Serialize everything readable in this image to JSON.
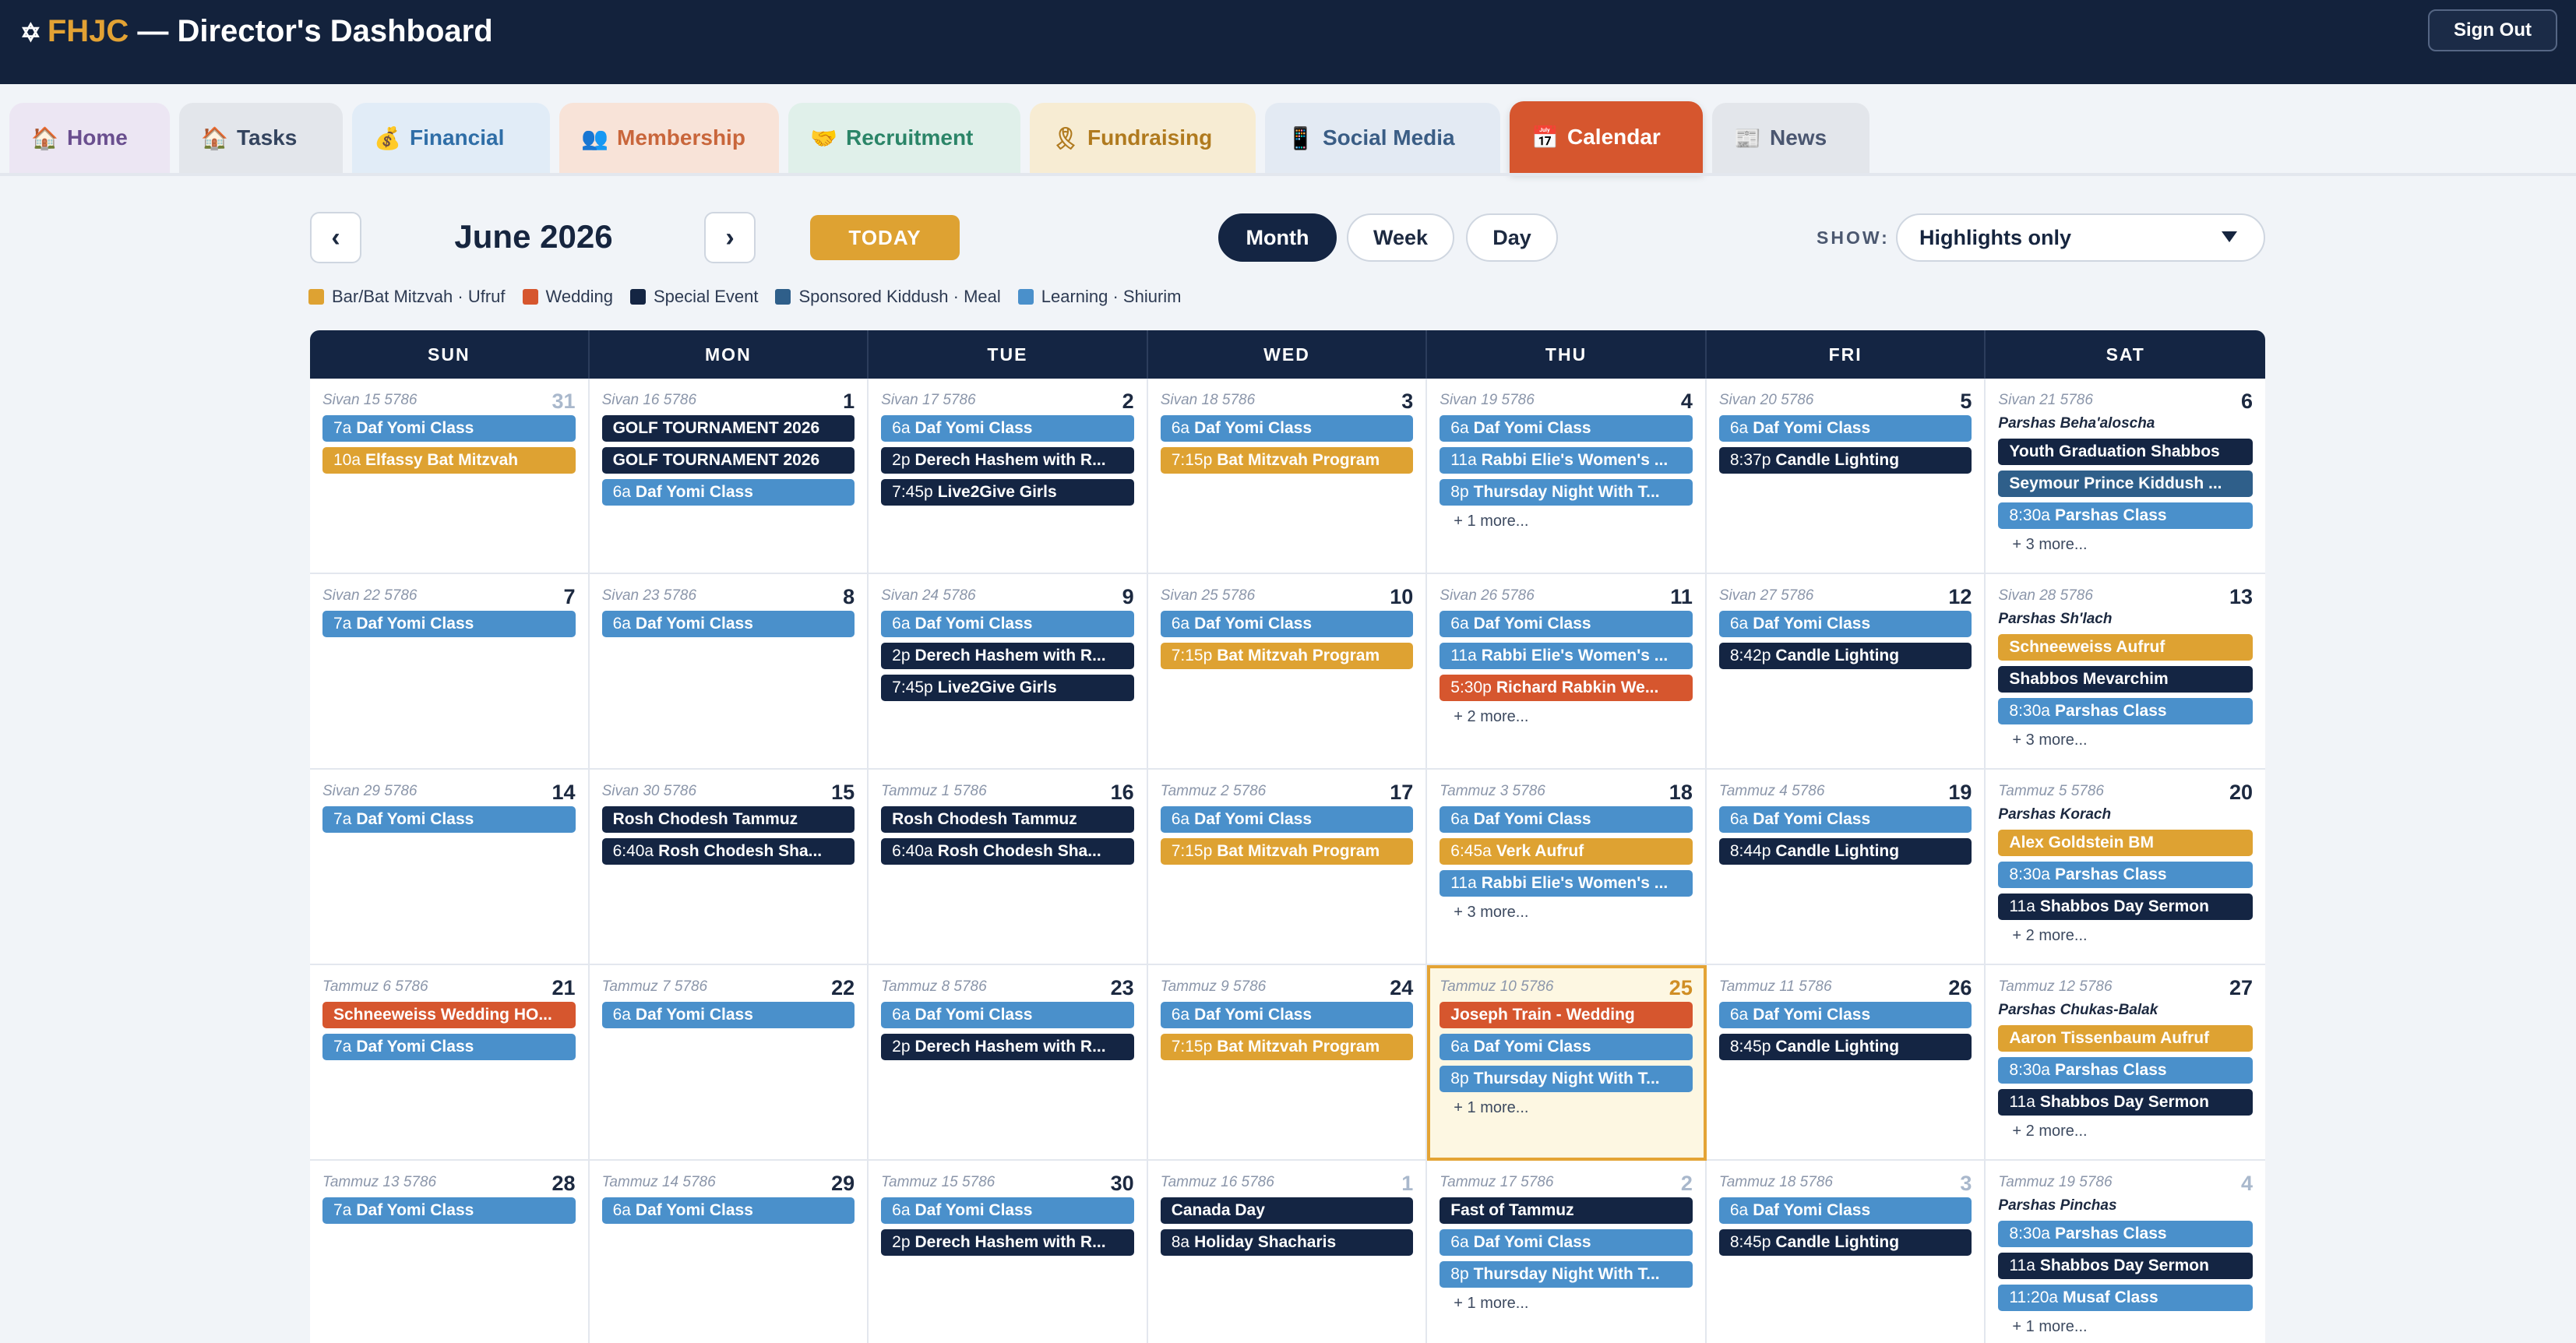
{
  "header": {
    "star": "✡",
    "org": "FHJC",
    "title": " — Director's Dashboard",
    "signout": "Sign Out"
  },
  "tabs": [
    {
      "id": "home",
      "icon": "🏠",
      "label": "Home",
      "bg": "#ece6f3",
      "color": "#6a4f8f"
    },
    {
      "id": "tasks",
      "icon": "🏠",
      "label": "Tasks",
      "bg": "#e3e6eb",
      "color": "#34445e"
    },
    {
      "id": "financial",
      "icon": "💰",
      "label": "Financial",
      "bg": "#e1ecf7",
      "color": "#2f6ea7"
    },
    {
      "id": "membership",
      "icon": "👥",
      "label": "Membership",
      "bg": "#f8e3d8",
      "color": "#c9663b"
    },
    {
      "id": "recruitment",
      "icon": "🤝",
      "label": "Recruitment",
      "bg": "#e0f0ea",
      "color": "#2b8568"
    },
    {
      "id": "fundraising",
      "icon": "🎗",
      "label": "Fundraising",
      "bg": "#f7ecd3",
      "color": "#b07a1e"
    },
    {
      "id": "social_media",
      "icon": "📱",
      "label": "Social Media",
      "bg": "#e3eaf3",
      "color": "#3a5d85"
    },
    {
      "id": "calendar",
      "icon": "📅",
      "label": "Calendar",
      "bg": "#d6562e",
      "color": "#ffffff"
    },
    {
      "id": "news",
      "icon": "📰",
      "label": "News",
      "bg": "#e3e6eb",
      "color": "#4a5670"
    }
  ],
  "active_tab": "calendar",
  "controls": {
    "prev": "‹",
    "next": "›",
    "month_title": "June 2026",
    "today": "TODAY",
    "views": [
      "Month",
      "Week",
      "Day"
    ],
    "active_view": "Month",
    "show_label": "SHOW:",
    "show_value": "Highlights only"
  },
  "legend": [
    {
      "label": "Bar/Bat Mitzvah · Ufruf",
      "color": "#dea232"
    },
    {
      "label": "Wedding",
      "color": "#d6562e"
    },
    {
      "label": "Special Event",
      "color": "#142543"
    },
    {
      "label": "Sponsored Kiddush · Meal",
      "color": "#2f5f8a"
    },
    {
      "label": "Learning · Shiurim",
      "color": "#4a90cb"
    }
  ],
  "colors": {
    "bar": "#dea232",
    "wed": "#d6562e",
    "spec": "#142543",
    "kid": "#2f5f8a",
    "learn": "#4a90cb"
  },
  "weekdays": [
    "SUN",
    "MON",
    "TUE",
    "WED",
    "THU",
    "FRI",
    "SAT"
  ],
  "weeks": [
    [
      {
        "hebrew": "Sivan 15 5786",
        "day": "31",
        "other": true,
        "events": [
          {
            "time": "7a",
            "title": "Daf Yomi Class",
            "type": "learn"
          },
          {
            "time": "10a",
            "title": "Elfassy Bat Mitzvah",
            "type": "bar"
          }
        ]
      },
      {
        "hebrew": "Sivan 16 5786",
        "day": "1",
        "events": [
          {
            "title": "GOLF TOURNAMENT 2026",
            "type": "spec"
          },
          {
            "title": "GOLF TOURNAMENT 2026",
            "type": "spec"
          },
          {
            "time": "6a",
            "title": "Daf Yomi Class",
            "type": "learn"
          }
        ]
      },
      {
        "hebrew": "Sivan 17 5786",
        "day": "2",
        "events": [
          {
            "time": "6a",
            "title": "Daf Yomi Class",
            "type": "learn"
          },
          {
            "time": "2p",
            "title": "Derech Hashem with R...",
            "type": "spec"
          },
          {
            "time": "7:45p",
            "title": "Live2Give Girls",
            "type": "spec"
          }
        ]
      },
      {
        "hebrew": "Sivan 18 5786",
        "day": "3",
        "events": [
          {
            "time": "6a",
            "title": "Daf Yomi Class",
            "type": "learn"
          },
          {
            "time": "7:15p",
            "title": "Bat Mitzvah Program",
            "type": "bar"
          }
        ]
      },
      {
        "hebrew": "Sivan 19 5786",
        "day": "4",
        "events": [
          {
            "time": "6a",
            "title": "Daf Yomi Class",
            "type": "learn"
          },
          {
            "time": "11a",
            "title": "Rabbi Elie's Women's ...",
            "type": "learn"
          },
          {
            "time": "8p",
            "title": "Thursday Night With T...",
            "type": "learn"
          }
        ],
        "more": "+ 1 more..."
      },
      {
        "hebrew": "Sivan 20 5786",
        "day": "5",
        "events": [
          {
            "time": "6a",
            "title": "Daf Yomi Class",
            "type": "learn"
          },
          {
            "time": "8:37p",
            "title": "Candle Lighting",
            "type": "spec"
          }
        ]
      },
      {
        "hebrew": "Sivan 21 5786",
        "day": "6",
        "parsha": "Parshas Beha'aloscha",
        "events": [
          {
            "title": "Youth Graduation Shabbos",
            "type": "spec"
          },
          {
            "title": "Seymour Prince Kiddush ...",
            "type": "kid"
          },
          {
            "time": "8:30a",
            "title": "Parshas Class",
            "type": "learn"
          }
        ],
        "more": "+ 3 more..."
      }
    ],
    [
      {
        "hebrew": "Sivan 22 5786",
        "day": "7",
        "events": [
          {
            "time": "7a",
            "title": "Daf Yomi Class",
            "type": "learn"
          }
        ]
      },
      {
        "hebrew": "Sivan 23 5786",
        "day": "8",
        "events": [
          {
            "time": "6a",
            "title": "Daf Yomi Class",
            "type": "learn"
          }
        ]
      },
      {
        "hebrew": "Sivan 24 5786",
        "day": "9",
        "events": [
          {
            "time": "6a",
            "title": "Daf Yomi Class",
            "type": "learn"
          },
          {
            "time": "2p",
            "title": "Derech Hashem with R...",
            "type": "spec"
          },
          {
            "time": "7:45p",
            "title": "Live2Give Girls",
            "type": "spec"
          }
        ]
      },
      {
        "hebrew": "Sivan 25 5786",
        "day": "10",
        "events": [
          {
            "time": "6a",
            "title": "Daf Yomi Class",
            "type": "learn"
          },
          {
            "time": "7:15p",
            "title": "Bat Mitzvah Program",
            "type": "bar"
          }
        ]
      },
      {
        "hebrew": "Sivan 26 5786",
        "day": "11",
        "events": [
          {
            "time": "6a",
            "title": "Daf Yomi Class",
            "type": "learn"
          },
          {
            "time": "11a",
            "title": "Rabbi Elie's Women's ...",
            "type": "learn"
          },
          {
            "time": "5:30p",
            "title": "Richard Rabkin We...",
            "type": "wed"
          }
        ],
        "more": "+ 2 more..."
      },
      {
        "hebrew": "Sivan 27 5786",
        "day": "12",
        "events": [
          {
            "time": "6a",
            "title": "Daf Yomi Class",
            "type": "learn"
          },
          {
            "time": "8:42p",
            "title": "Candle Lighting",
            "type": "spec"
          }
        ]
      },
      {
        "hebrew": "Sivan 28 5786",
        "day": "13",
        "parsha": "Parshas Sh'lach",
        "events": [
          {
            "title": "Schneeweiss Aufruf",
            "type": "bar"
          },
          {
            "title": "Shabbos Mevarchim",
            "type": "spec"
          },
          {
            "time": "8:30a",
            "title": "Parshas Class",
            "type": "learn"
          }
        ],
        "more": "+ 3 more..."
      }
    ],
    [
      {
        "hebrew": "Sivan 29 5786",
        "day": "14",
        "events": [
          {
            "time": "7a",
            "title": "Daf Yomi Class",
            "type": "learn"
          }
        ]
      },
      {
        "hebrew": "Sivan 30 5786",
        "day": "15",
        "events": [
          {
            "title": "Rosh Chodesh Tammuz",
            "type": "spec"
          },
          {
            "time": "6:40a",
            "title": "Rosh Chodesh Sha...",
            "type": "spec"
          }
        ]
      },
      {
        "hebrew": "Tammuz 1 5786",
        "day": "16",
        "events": [
          {
            "title": "Rosh Chodesh Tammuz",
            "type": "spec"
          },
          {
            "time": "6:40a",
            "title": "Rosh Chodesh Sha...",
            "type": "spec"
          }
        ]
      },
      {
        "hebrew": "Tammuz 2 5786",
        "day": "17",
        "events": [
          {
            "time": "6a",
            "title": "Daf Yomi Class",
            "type": "learn"
          },
          {
            "time": "7:15p",
            "title": "Bat Mitzvah Program",
            "type": "bar"
          }
        ]
      },
      {
        "hebrew": "Tammuz 3 5786",
        "day": "18",
        "events": [
          {
            "time": "6a",
            "title": "Daf Yomi Class",
            "type": "learn"
          },
          {
            "time": "6:45a",
            "title": "Verk Aufruf",
            "type": "bar"
          },
          {
            "time": "11a",
            "title": "Rabbi Elie's Women's ...",
            "type": "learn"
          }
        ],
        "more": "+ 3 more..."
      },
      {
        "hebrew": "Tammuz 4 5786",
        "day": "19",
        "events": [
          {
            "time": "6a",
            "title": "Daf Yomi Class",
            "type": "learn"
          },
          {
            "time": "8:44p",
            "title": "Candle Lighting",
            "type": "spec"
          }
        ]
      },
      {
        "hebrew": "Tammuz 5 5786",
        "day": "20",
        "parsha": "Parshas Korach",
        "events": [
          {
            "title": "Alex Goldstein BM",
            "type": "bar"
          },
          {
            "time": "8:30a",
            "title": "Parshas Class",
            "type": "learn"
          },
          {
            "time": "11a",
            "title": "Shabbos Day Sermon",
            "type": "spec"
          }
        ],
        "more": "+ 2 more..."
      }
    ],
    [
      {
        "hebrew": "Tammuz 6 5786",
        "day": "21",
        "events": [
          {
            "title": "Schneeweiss Wedding HO...",
            "type": "wed"
          },
          {
            "time": "7a",
            "title": "Daf Yomi Class",
            "type": "learn"
          }
        ]
      },
      {
        "hebrew": "Tammuz 7 5786",
        "day": "22",
        "events": [
          {
            "time": "6a",
            "title": "Daf Yomi Class",
            "type": "learn"
          }
        ]
      },
      {
        "hebrew": "Tammuz 8 5786",
        "day": "23",
        "events": [
          {
            "time": "6a",
            "title": "Daf Yomi Class",
            "type": "learn"
          },
          {
            "time": "2p",
            "title": "Derech Hashem with R...",
            "type": "spec"
          }
        ]
      },
      {
        "hebrew": "Tammuz 9 5786",
        "day": "24",
        "events": [
          {
            "time": "6a",
            "title": "Daf Yomi Class",
            "type": "learn"
          },
          {
            "time": "7:15p",
            "title": "Bat Mitzvah Program",
            "type": "bar"
          }
        ]
      },
      {
        "hebrew": "Tammuz 10 5786",
        "day": "25",
        "today": true,
        "events": [
          {
            "title": "Joseph Train - Wedding",
            "type": "wed"
          },
          {
            "time": "6a",
            "title": "Daf Yomi Class",
            "type": "learn"
          },
          {
            "time": "8p",
            "title": "Thursday Night With T...",
            "type": "learn"
          }
        ],
        "more": "+ 1 more..."
      },
      {
        "hebrew": "Tammuz 11 5786",
        "day": "26",
        "events": [
          {
            "time": "6a",
            "title": "Daf Yomi Class",
            "type": "learn"
          },
          {
            "time": "8:45p",
            "title": "Candle Lighting",
            "type": "spec"
          }
        ]
      },
      {
        "hebrew": "Tammuz 12 5786",
        "day": "27",
        "parsha": "Parshas Chukas-Balak",
        "events": [
          {
            "title": "Aaron Tissenbaum Aufruf",
            "type": "bar"
          },
          {
            "time": "8:30a",
            "title": "Parshas Class",
            "type": "learn"
          },
          {
            "time": "11a",
            "title": "Shabbos Day Sermon",
            "type": "spec"
          }
        ],
        "more": "+ 2 more..."
      }
    ],
    [
      {
        "hebrew": "Tammuz 13 5786",
        "day": "28",
        "events": [
          {
            "time": "7a",
            "title": "Daf Yomi Class",
            "type": "learn"
          }
        ]
      },
      {
        "hebrew": "Tammuz 14 5786",
        "day": "29",
        "events": [
          {
            "time": "6a",
            "title": "Daf Yomi Class",
            "type": "learn"
          }
        ]
      },
      {
        "hebrew": "Tammuz 15 5786",
        "day": "30",
        "events": [
          {
            "time": "6a",
            "title": "Daf Yomi Class",
            "type": "learn"
          },
          {
            "time": "2p",
            "title": "Derech Hashem with R...",
            "type": "spec"
          }
        ]
      },
      {
        "hebrew": "Tammuz 16 5786",
        "day": "1",
        "other": true,
        "events": [
          {
            "title": "Canada Day",
            "type": "spec"
          },
          {
            "time": "8a",
            "title": "Holiday Shacharis",
            "type": "spec"
          }
        ]
      },
      {
        "hebrew": "Tammuz 17 5786",
        "day": "2",
        "other": true,
        "events": [
          {
            "title": "Fast of Tammuz",
            "type": "spec"
          },
          {
            "time": "6a",
            "title": "Daf Yomi Class",
            "type": "learn"
          },
          {
            "time": "8p",
            "title": "Thursday Night With T...",
            "type": "learn"
          }
        ],
        "more": "+ 1 more..."
      },
      {
        "hebrew": "Tammuz 18 5786",
        "day": "3",
        "other": true,
        "events": [
          {
            "time": "6a",
            "title": "Daf Yomi Class",
            "type": "learn"
          },
          {
            "time": "8:45p",
            "title": "Candle Lighting",
            "type": "spec"
          }
        ]
      },
      {
        "hebrew": "Tammuz 19 5786",
        "day": "4",
        "other": true,
        "parsha": "Parshas Pinchas",
        "events": [
          {
            "time": "8:30a",
            "title": "Parshas Class",
            "type": "learn"
          },
          {
            "time": "11a",
            "title": "Shabbos Day Sermon",
            "type": "spec"
          },
          {
            "time": "11:20a",
            "title": "Musaf Class",
            "type": "learn"
          }
        ],
        "more": "+ 1 more..."
      }
    ]
  ]
}
